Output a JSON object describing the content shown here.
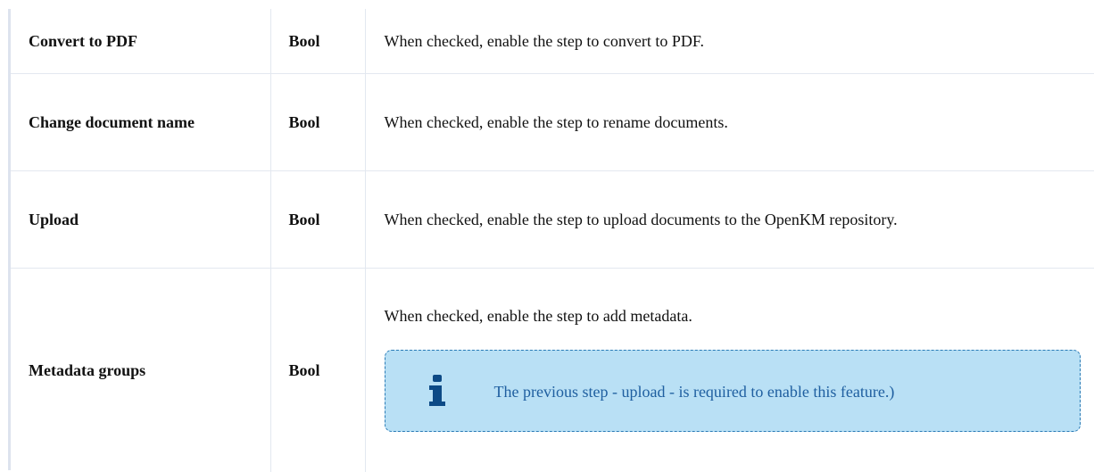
{
  "table": {
    "rows": [
      {
        "name": "Convert to PDF",
        "type": "Bool",
        "description": "When checked, enable the step to convert to PDF."
      },
      {
        "name": "Change document name",
        "type": "Bool",
        "description": "When checked, enable the step to rename documents."
      },
      {
        "name": "Upload",
        "type": "Bool",
        "description": "When checked, enable the step to upload documents to the OpenKM repository."
      },
      {
        "name": "Metadata groups",
        "type": "Bool",
        "description": "When checked, enable the step to add metadata.",
        "note": {
          "icon": "info-icon",
          "text": "The previous step - upload -  is required to enable this feature.)",
          "background": "#b9e0f5",
          "border": "#2a7bb6",
          "text_color": "#1f5fa0"
        }
      }
    ]
  }
}
